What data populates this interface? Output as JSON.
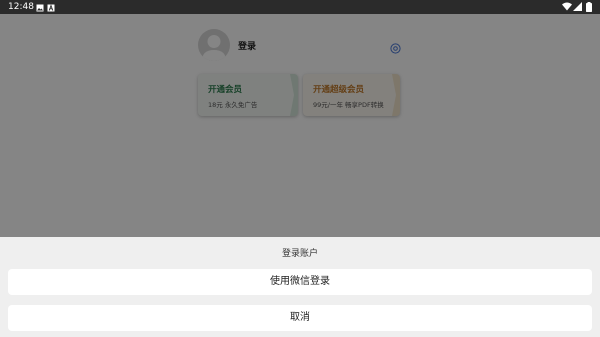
{
  "status_bar": {
    "time": "12:48",
    "icons": [
      "image-icon",
      "a-icon",
      "wifi-icon",
      "signal-icon",
      "battery-icon"
    ]
  },
  "profile": {
    "login_label": "登录"
  },
  "cards": {
    "vip": {
      "title": "开通会员",
      "subtitle": "18元 永久免广告",
      "title_color": "#2e7d4f"
    },
    "svip": {
      "title": "开通超级会员",
      "subtitle": "99元/一年 畅享PDF转换",
      "title_color": "#c07a2b"
    }
  },
  "sheet": {
    "title": "登录账户",
    "wechat_login_label": "使用微信登录",
    "cancel_label": "取消"
  },
  "colors": {
    "accent_blue": "#4a78d6"
  }
}
